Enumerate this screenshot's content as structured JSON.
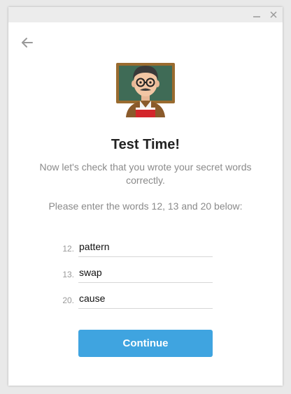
{
  "window": {
    "controls": {
      "minimize_icon": "minimize-icon",
      "close_icon": "close-icon"
    }
  },
  "nav": {
    "back_icon": "arrow-left-icon"
  },
  "illustration": {
    "icon": "teacher-at-chalkboard-emoji"
  },
  "title": "Test Time!",
  "description": "Now let's check that you wrote your secret words correctly.",
  "prompt": "Please enter the words 12, 13 and 20 below:",
  "words": [
    {
      "number": "12.",
      "value": "pattern"
    },
    {
      "number": "13.",
      "value": "swap"
    },
    {
      "number": "20.",
      "value": "cause"
    }
  ],
  "continue_label": "Continue",
  "colors": {
    "accent": "#3fa4e0",
    "title_text": "#222222",
    "muted_text": "#8a8a8a",
    "chalkboard": "#3f6b56",
    "board_frame": "#9a6b2f"
  }
}
